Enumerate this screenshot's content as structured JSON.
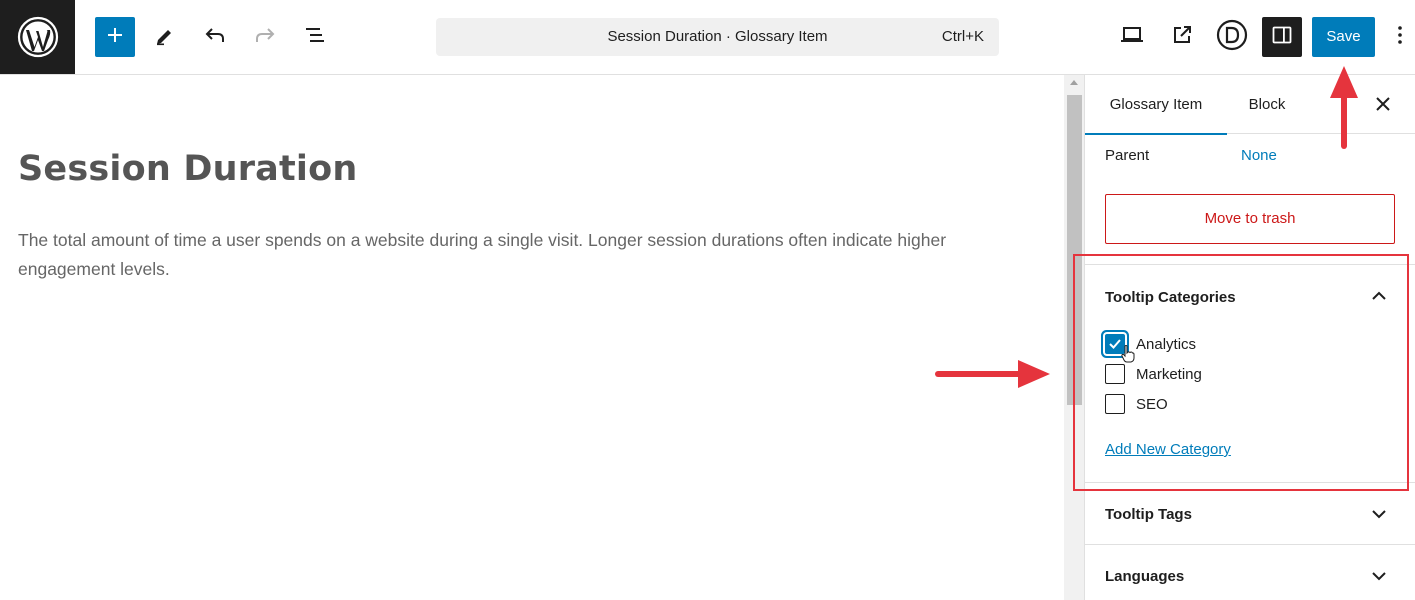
{
  "toolbar": {
    "logo_icon": "wordpress-logo-icon",
    "inserter_icon": "plus-icon",
    "tools_icon": "pencil-icon",
    "undo_icon": "undo-icon",
    "redo_icon": "redo-icon",
    "list_view_icon": "list-view-icon",
    "command": {
      "title": "Session Duration · Glossary Item",
      "shortcut": "Ctrl+K"
    },
    "preview_icon": "laptop-icon",
    "view_post_icon": "external-link-icon",
    "divi_icon": "divi-d-icon",
    "settings_icon": "sidebar-toggle-icon",
    "save_label": "Save",
    "options_icon": "kebab-menu-icon"
  },
  "post": {
    "title": "Session Duration",
    "body": "The total amount of time a user spends on a website during a single visit. Longer session durations often indicate higher engagement levels."
  },
  "sidebar": {
    "tabs": [
      {
        "label": "Glossary Item",
        "active": true
      },
      {
        "label": "Block",
        "active": false
      }
    ],
    "parent_label": "Parent",
    "parent_value": "None",
    "trash_label": "Move to trash",
    "tooltip_categories": {
      "title": "Tooltip Categories",
      "expanded": true,
      "items": [
        {
          "label": "Analytics",
          "checked": true
        },
        {
          "label": "Marketing",
          "checked": false
        },
        {
          "label": "SEO",
          "checked": false
        }
      ],
      "add_new_label": "Add New Category"
    },
    "tooltip_tags": {
      "title": "Tooltip Tags",
      "expanded": false
    },
    "languages": {
      "title": "Languages",
      "expanded": false
    }
  },
  "colors": {
    "accent": "#007cba",
    "dark": "#1e1e1e",
    "danger": "#cc1818",
    "annotation": "#e5343d"
  }
}
